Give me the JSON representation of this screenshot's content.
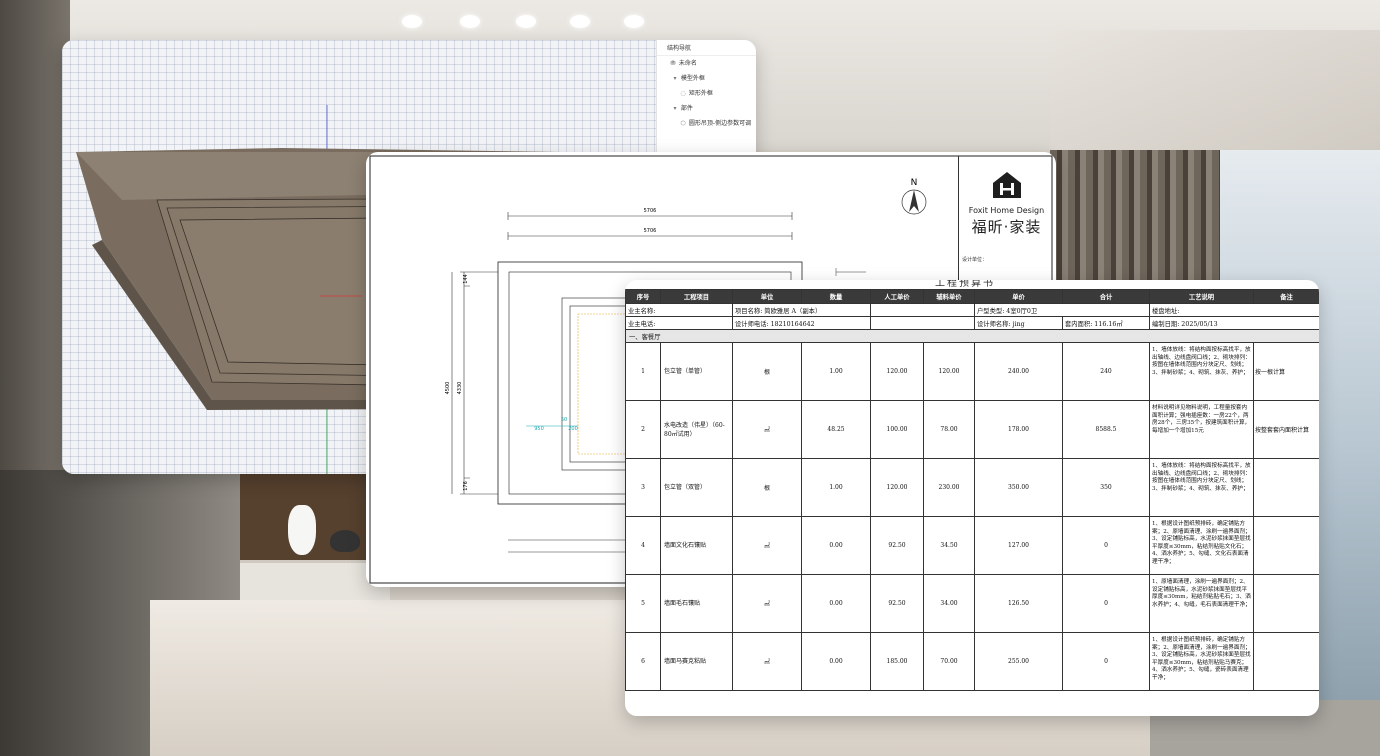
{
  "nav_panel": {
    "title": "结构导航",
    "items": [
      {
        "label": "未命名"
      },
      {
        "label": "模型外框"
      },
      {
        "label": "矩形外框"
      },
      {
        "label": "部件"
      },
      {
        "label": "圆形吊顶-侧边参数可调"
      }
    ]
  },
  "drawing": {
    "north": "N",
    "dim_top_1": "5706",
    "dim_top_2": "5706",
    "dim_left_outer": "4500",
    "dim_left_inner": "4330",
    "dim_left_top": "144",
    "dim_left_bottom": "176",
    "dim_cyan_1": "950",
    "dim_cyan_2": "200",
    "dim_cyan_3": "50",
    "logo_en": "Foxit Home Design",
    "logo_zh": "福昕·家装",
    "design_unit": "设计单位：",
    "sheet_title": "工程预算书"
  },
  "quote": {
    "info_row1": {
      "owner_name": "业主名称:",
      "project_name": "项目名称:  简欧雅居 A（副本）",
      "house_type": "户型类型:  4室0厅0卫",
      "address": "楼盘地址:"
    },
    "info_row2": {
      "owner_phone": "业主电话:",
      "designer_phone": "设计师电话:  18210164642",
      "designer_name": "设计师名称:  jing",
      "area": "套内面积:  116.16㎡",
      "date": "编制日期:  2025/05/13"
    },
    "headers": [
      "序号",
      "工程项目",
      "单位",
      "数量",
      "人工单价",
      "辅料单价",
      "单价",
      "合计",
      "工艺说明",
      "备注"
    ],
    "section": "一、客餐厅",
    "rows": [
      {
        "no": "1",
        "name": "包立管（单管）",
        "unit": "根",
        "qty": "1.00",
        "labor": "120.00",
        "aux": "120.00",
        "price": "240.00",
        "total": "240",
        "desc": "1、墙体放线：将结构面按标高找平，放出轴线、边线盘阀口线；2、砌块排列：按图在墙体线范围内分块定尺、划线；3、拌制砂浆；4、砌筑、抹灰、养护；",
        "remark": "按一根计算"
      },
      {
        "no": "2",
        "name": "水电改造（伟星）（60-80㎡试用）",
        "unit": "㎡",
        "qty": "48.25",
        "labor": "100.00",
        "aux": "78.00",
        "price": "178.00",
        "total": "8588.5",
        "desc": "材料说明详见物料说明，工程量按套内面积计算；强电插座数：一房22个，两房28个，三房35个，按建筑面积计算，每增加一个增加15元",
        "remark": "按整套套内面积计算"
      },
      {
        "no": "3",
        "name": "包立管（双管）",
        "unit": "根",
        "qty": "1.00",
        "labor": "120.00",
        "aux": "230.00",
        "price": "350.00",
        "total": "350",
        "desc": "1、墙体放线：将结构面按标高找平，放出轴线、边线盘阀口线；2、砌块排列：按图在墙体线范围内分块定尺、划线；3、拌制砂浆；4、砌筑、抹灰、养护；",
        "remark": ""
      },
      {
        "no": "4",
        "name": "墙面文化石镶贴",
        "unit": "㎡",
        "qty": "0.00",
        "labor": "92.50",
        "aux": "34.50",
        "price": "127.00",
        "total": "0",
        "desc": "1、根据设计图纸预排砖，确定铺贴方案；2、原墙面清理、涂刷一遍界面剂；3、设定铺贴标高，水泥砂浆抹面垫层找平厚度≤30mm，粘结剂粘贴文化石；4、洒水养护；5、勾缝、文化石表面清理干净；",
        "remark": ""
      },
      {
        "no": "5",
        "name": "墙面毛石镶贴",
        "unit": "㎡",
        "qty": "0.00",
        "labor": "92.50",
        "aux": "34.00",
        "price": "126.50",
        "total": "0",
        "desc": "1、原墙面清理，涂刷一遍界面剂；2、设定铺贴标高，水泥砂浆抹面垫层找平厚度≤30mm，粘结剂粘贴毛石；3、洒水养护；4、勾缝，毛石表面清理干净；",
        "remark": ""
      },
      {
        "no": "6",
        "name": "墙面马赛克粘贴",
        "unit": "㎡",
        "qty": "0.00",
        "labor": "185.00",
        "aux": "70.00",
        "price": "255.00",
        "total": "0",
        "desc": "1、根据设计图纸预排砖，确定铺贴方案；2、原墙面清理，涂刷一遍界面剂；3、设定铺贴标高，水泥砂浆抹面垫层找平厚度≤30mm，粘结剂粘贴马赛克；4、洒水养护；5、勾缝，瓷砖表面清理干净；",
        "remark": ""
      }
    ]
  }
}
